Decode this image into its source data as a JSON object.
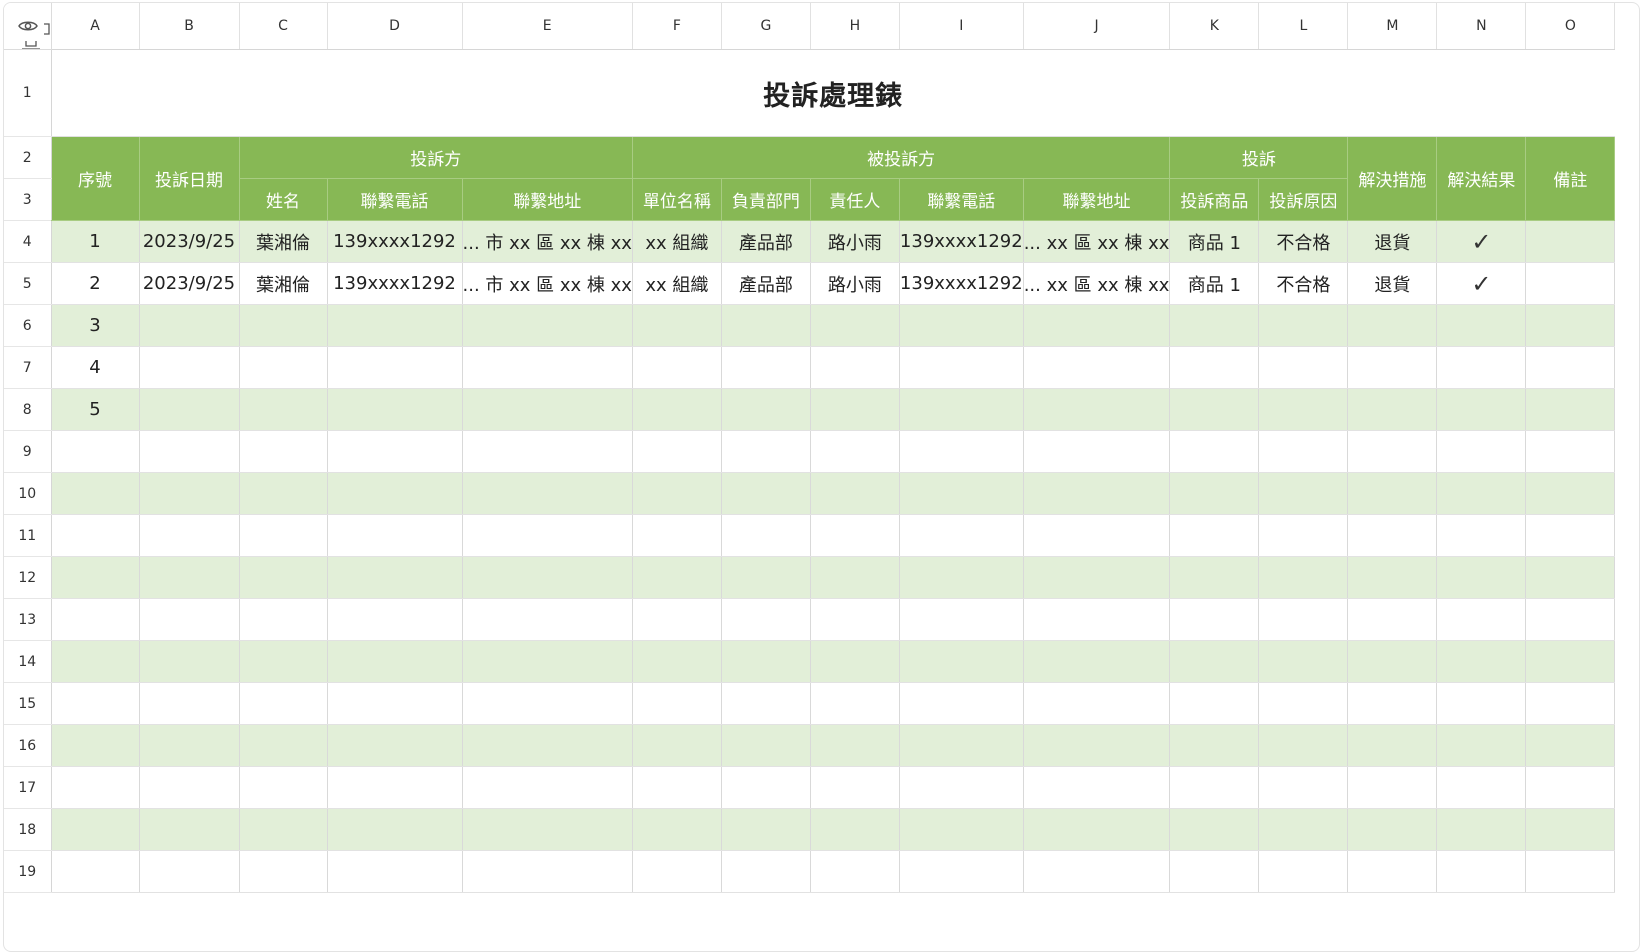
{
  "columns": [
    "A",
    "B",
    "C",
    "D",
    "E",
    "F",
    "G",
    "H",
    "I",
    "J",
    "K",
    "L",
    "M",
    "N",
    "O"
  ],
  "title": "投訴處理錶",
  "header": {
    "seq": "序號",
    "date": "投訴日期",
    "complainant": "投訴方",
    "respondent": "被投訴方",
    "complaint": "投訴",
    "solution": "解決措施",
    "result": "解決結果",
    "remark": "備註",
    "name": "姓名",
    "phone": "聯繫電話",
    "address": "聯繫地址",
    "unit": "單位名稱",
    "dept": "負責部門",
    "person": "責任人",
    "r_phone": "聯繫電話",
    "r_address": "聯繫地址",
    "product": "投訴商品",
    "reason": "投訴原因"
  },
  "rows": [
    {
      "num": "4",
      "cells": [
        "1",
        "2023/9/25",
        "葉湘倫",
        "139xxxx1292",
        "... 市 xx 區 xx 棟 xx",
        "xx 組織",
        "產品部",
        "路小雨",
        "139xxxx1292",
        "... xx 區 xx 棟 xx",
        "商品 1",
        "不合格",
        "退貨",
        "✓",
        ""
      ]
    },
    {
      "num": "5",
      "cells": [
        "2",
        "2023/9/25",
        "葉湘倫",
        "139xxxx1292",
        "... 市 xx 區 xx 棟 xx",
        "xx 組織",
        "產品部",
        "路小雨",
        "139xxxx1292",
        "... xx 區 xx 棟 xx",
        "商品 1",
        "不合格",
        "退貨",
        "✓",
        ""
      ]
    },
    {
      "num": "6",
      "cells": [
        "3",
        "",
        "",
        "",
        "",
        "",
        "",
        "",
        "",
        "",
        "",
        "",
        "",
        "",
        ""
      ]
    },
    {
      "num": "7",
      "cells": [
        "4",
        "",
        "",
        "",
        "",
        "",
        "",
        "",
        "",
        "",
        "",
        "",
        "",
        "",
        ""
      ]
    },
    {
      "num": "8",
      "cells": [
        "5",
        "",
        "",
        "",
        "",
        "",
        "",
        "",
        "",
        "",
        "",
        "",
        "",
        "",
        ""
      ]
    },
    {
      "num": "9",
      "cells": [
        "",
        "",
        "",
        "",
        "",
        "",
        "",
        "",
        "",
        "",
        "",
        "",
        "",
        "",
        ""
      ]
    },
    {
      "num": "10",
      "cells": [
        "",
        "",
        "",
        "",
        "",
        "",
        "",
        "",
        "",
        "",
        "",
        "",
        "",
        "",
        ""
      ]
    },
    {
      "num": "11",
      "cells": [
        "",
        "",
        "",
        "",
        "",
        "",
        "",
        "",
        "",
        "",
        "",
        "",
        "",
        "",
        ""
      ]
    },
    {
      "num": "12",
      "cells": [
        "",
        "",
        "",
        "",
        "",
        "",
        "",
        "",
        "",
        "",
        "",
        "",
        "",
        "",
        ""
      ]
    },
    {
      "num": "13",
      "cells": [
        "",
        "",
        "",
        "",
        "",
        "",
        "",
        "",
        "",
        "",
        "",
        "",
        "",
        "",
        ""
      ]
    },
    {
      "num": "14",
      "cells": [
        "",
        "",
        "",
        "",
        "",
        "",
        "",
        "",
        "",
        "",
        "",
        "",
        "",
        "",
        ""
      ]
    },
    {
      "num": "15",
      "cells": [
        "",
        "",
        "",
        "",
        "",
        "",
        "",
        "",
        "",
        "",
        "",
        "",
        "",
        "",
        ""
      ]
    },
    {
      "num": "16",
      "cells": [
        "",
        "",
        "",
        "",
        "",
        "",
        "",
        "",
        "",
        "",
        "",
        "",
        "",
        "",
        ""
      ]
    },
    {
      "num": "17",
      "cells": [
        "",
        "",
        "",
        "",
        "",
        "",
        "",
        "",
        "",
        "",
        "",
        "",
        "",
        "",
        ""
      ]
    },
    {
      "num": "18",
      "cells": [
        "",
        "",
        "",
        "",
        "",
        "",
        "",
        "",
        "",
        "",
        "",
        "",
        "",
        "",
        ""
      ]
    },
    {
      "num": "19",
      "cells": [
        "",
        "",
        "",
        "",
        "",
        "",
        "",
        "",
        "",
        "",
        "",
        "",
        "",
        "",
        ""
      ]
    }
  ],
  "icons": {
    "corner_left": "eye-icon",
    "corner_right": "split-columns-icon",
    "corner_bottom": "split-rows-icon"
  },
  "colors": {
    "header_green": "#87b855",
    "band_green": "#e2efd8",
    "white": "#ffffff"
  }
}
